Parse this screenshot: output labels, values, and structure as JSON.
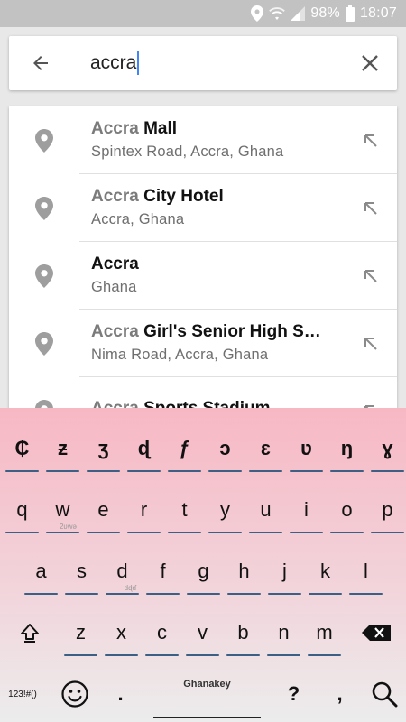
{
  "status_bar": {
    "battery": "98%",
    "time": "18:07"
  },
  "search": {
    "query": "accra"
  },
  "results": [
    {
      "match": "Accra",
      "rest": " Mall",
      "subtitle": "Spintex Road, Accra, Ghana"
    },
    {
      "match": "Accra",
      "rest": " City Hotel",
      "subtitle": "Accra, Ghana"
    },
    {
      "match": "Accra",
      "rest": "",
      "subtitle": "Ghana"
    },
    {
      "match": "Accra",
      "rest": " Girl's Senior High S…",
      "subtitle": "Nima Road, Accra, Ghana"
    },
    {
      "match": "Accra",
      "rest": " Sports Stadium",
      "subtitle": ""
    }
  ],
  "keyboard": {
    "row1": [
      "₵",
      "ƶ",
      "ʒ",
      "ɖ",
      "ƒ",
      "ɔ",
      "ɛ",
      "ʋ",
      "ŋ",
      "ɣ"
    ],
    "row2": [
      "q",
      "w",
      "e",
      "r",
      "t",
      "y",
      "u",
      "i",
      "o",
      "p"
    ],
    "row2_hints": [
      "",
      "2ʋwə",
      "",
      "",
      "",
      "",
      "",
      "",
      "",
      ""
    ],
    "row3": [
      "a",
      "s",
      "d",
      "f",
      "g",
      "h",
      "j",
      "k",
      "l"
    ],
    "row3_hints": [
      "",
      "",
      "dɖɗ",
      "",
      "",
      "",
      "",
      "",
      ""
    ],
    "row4": [
      "z",
      "x",
      "c",
      "v",
      "b",
      "n",
      "m"
    ],
    "row4_hints": [
      "",
      "",
      "",
      "",
      "",
      "",
      ""
    ],
    "symbols_label": "123!#()",
    "space_label": "Ghanakey",
    "period": ".",
    "question": "?",
    "comma": ","
  }
}
